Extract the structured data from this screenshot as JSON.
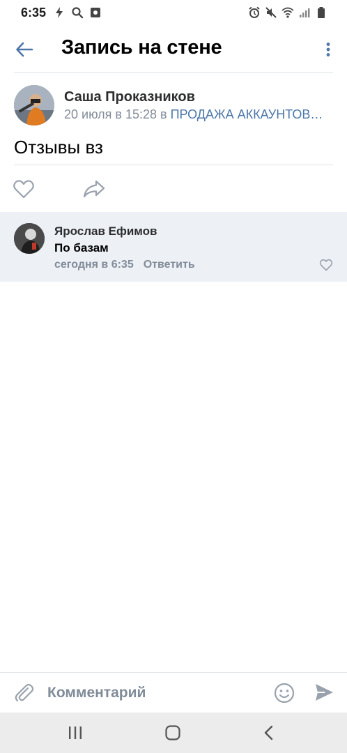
{
  "status_bar": {
    "time": "6:35",
    "left_icons": [
      "flash-icon",
      "search-icon",
      "screen-record-icon"
    ],
    "right_icons": [
      "alarm-icon",
      "mute-icon",
      "wifi-icon",
      "signal-icon",
      "battery-icon"
    ]
  },
  "header": {
    "title": "Запись на стене",
    "back_icon": "arrow-left-icon",
    "more_icon": "more-vertical-icon"
  },
  "post": {
    "author": "Саша Проказников",
    "date": "20 июля в 15:28 в ",
    "group": "ПРОДАЖА АККАУНТОВ…",
    "text": "Отзывы вз",
    "actions": [
      "like-icon",
      "share-icon"
    ]
  },
  "comment": {
    "author": "Ярослав Ефимов",
    "text": "По базам",
    "time": "сегодня в 6:35",
    "reply_label": "Ответить"
  },
  "composer": {
    "placeholder": "Комментарий",
    "icons": [
      "paperclip-icon",
      "emoji-icon",
      "send-icon"
    ]
  },
  "colors": {
    "accent": "#4a76a8",
    "secondary_text": "#818c99",
    "comment_bg": "#edf0f5",
    "navbar_bg": "#ececec"
  }
}
